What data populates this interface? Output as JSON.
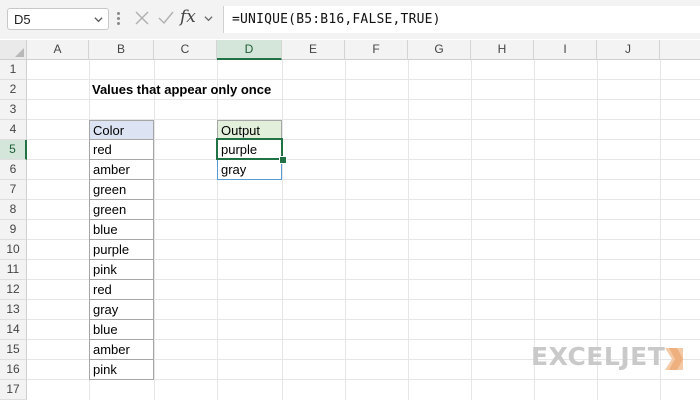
{
  "formula_bar": {
    "name_box": "D5",
    "fx_label": "fx",
    "formula": "=UNIQUE(B5:B16,FALSE,TRUE)"
  },
  "columns": [
    "A",
    "B",
    "C",
    "D",
    "E",
    "F",
    "G",
    "H",
    "I",
    "J"
  ],
  "rows": [
    "1",
    "2",
    "3",
    "4",
    "5",
    "6",
    "7",
    "8",
    "9",
    "10",
    "11",
    "12",
    "13",
    "14",
    "15",
    "16",
    "17"
  ],
  "active_cell": {
    "column": "D",
    "row": "5"
  },
  "sheet": {
    "title": "Values that appear only once",
    "color_header": "Color",
    "colors": [
      "red",
      "amber",
      "green",
      "green",
      "blue",
      "purple",
      "pink",
      "red",
      "gray",
      "blue",
      "amber",
      "pink"
    ],
    "output_header": "Output",
    "output": [
      "purple",
      "gray"
    ]
  },
  "watermark": {
    "brand": "EXCELJET"
  },
  "colors": {
    "accent_green": "#217346",
    "color_header_fill": "#dce3f3",
    "output_header_fill": "#e2efdb",
    "spill_border": "#5b9bd5"
  }
}
